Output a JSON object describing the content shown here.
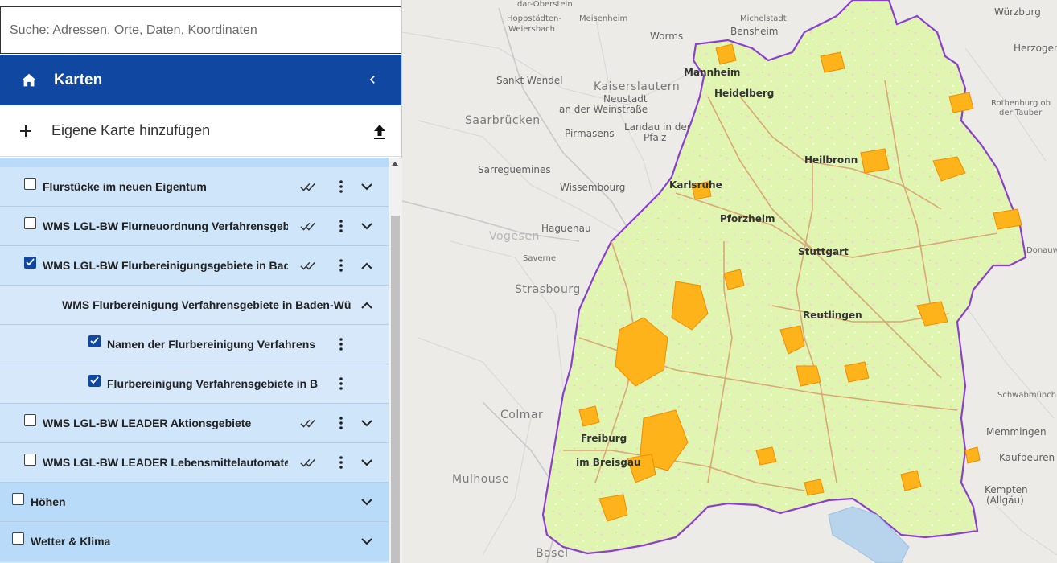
{
  "search": {
    "placeholder": "Suche: Adressen, Orte, Daten, Koordinaten"
  },
  "header": {
    "title": "Karten",
    "home_icon": "home-icon",
    "collapse_icon": "chevron-left-icon"
  },
  "add_map": {
    "label": "Eigene Karte hinzufügen",
    "plus_icon": "plus-icon",
    "upload_icon": "upload-icon"
  },
  "layers": [
    {
      "label": "Flurstücke im neuen Eigentum",
      "checked": false
    },
    {
      "label": "WMS LGL-BW Flurneuordnung Verfahrensgebi",
      "checked": false
    },
    {
      "label": "WMS LGL-BW Flurbereinigungsgebiete in Bad",
      "checked": true
    },
    {
      "label": "WMS Flurbereinigung Verfahrensgebiete in Baden-Wü"
    },
    {
      "label": "Namen der Flurbereinigung Verfahrens",
      "checked": true
    },
    {
      "label": "Flurbereinigung Verfahrensgebiete in B",
      "checked": true
    },
    {
      "label": "WMS LGL-BW LEADER Aktionsgebiete",
      "checked": false
    },
    {
      "label": "WMS LGL-BW LEADER Lebensmittelautomaten",
      "checked": false
    },
    {
      "label": "Höhen",
      "checked": false
    },
    {
      "label": "Wetter & Klima",
      "checked": false
    }
  ],
  "map_labels": {
    "idar": "Idar-Oberstein",
    "hoppstaedten": "Hoppstädten-",
    "weiersbach": "Weiersbach",
    "meisenheim": "Meisenheim",
    "worms": "Worms",
    "bensheim": "Bensheim",
    "michelstadt": "Michelstadt",
    "mannheim": "Mannheim",
    "heidelberg": "Heidelberg",
    "kaiserslautern": "Kaiserslautern",
    "neustadt": "Neustadt",
    "weinstrasse": "an der Weinstraße",
    "saarbruecken": "Saarbrücken",
    "pirmasens": "Pirmasens",
    "landau": "Landau in der",
    "pfalz": "Pfalz",
    "karlsruhe": "Karlsruhe",
    "heilbronn": "Heilbronn",
    "pforzheim": "Pforzheim",
    "stuttgart": "Stuttgart",
    "reutlingen": "Reutlingen",
    "strasbourg": "Strasbourg",
    "haguenau": "Haguenau",
    "colmar": "Colmar",
    "freiburg": "Freiburg",
    "breisgau": "im Breisgau",
    "mulhouse": "Mulhouse",
    "basel": "Basel",
    "kempten": "Kempten",
    "allgaeu": "(Allgäu)",
    "memmingen": "Memmingen",
    "kaufbeuren": "Kaufbeuren",
    "herzogena": "Herzogena",
    "wuerzburg": "Würzburg",
    "rothenburg": "Rothenburg ob",
    "tauber": "der Tauber",
    "sankt_wendel": "Sankt Wendel",
    "vogesen": "Vogesen",
    "sarreguemines": "Sarreguemines",
    "wissembourg": "Wissembourg",
    "saverne": "Saverne",
    "schwabmuench": "Schwabmünch",
    "donauw": "Donauw"
  },
  "colors": {
    "header_bg": "#0f47a1",
    "layer_bg": "#cfe5fa",
    "group_bg": "#b7dbf8",
    "state_fill": "#dff5b0",
    "state_border": "#8a3fcf",
    "fb_area": "#ffb31a"
  }
}
